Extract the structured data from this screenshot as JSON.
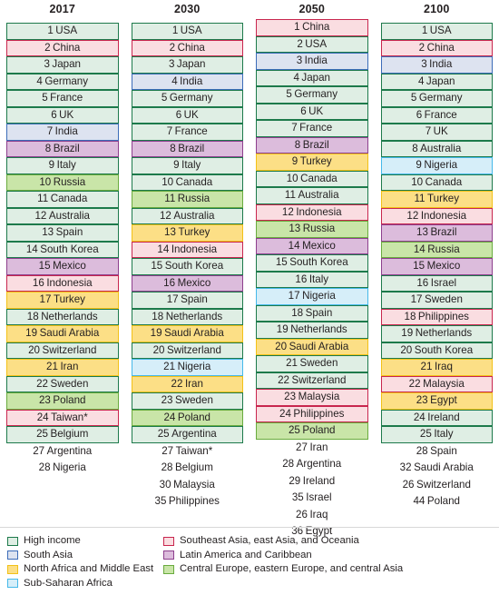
{
  "chart_data": {
    "type": "table",
    "title": "",
    "columns": [
      {
        "header": "2017",
        "ranked": [
          {
            "rank": "1",
            "name": "USA",
            "category": "high"
          },
          {
            "rank": "2",
            "name": "China",
            "category": "seasia"
          },
          {
            "rank": "3",
            "name": "Japan",
            "category": "high"
          },
          {
            "rank": "4",
            "name": "Germany",
            "category": "high"
          },
          {
            "rank": "5",
            "name": "France",
            "category": "high"
          },
          {
            "rank": "6",
            "name": "UK",
            "category": "high"
          },
          {
            "rank": "7",
            "name": "India",
            "category": "south"
          },
          {
            "rank": "8",
            "name": "Brazil",
            "category": "latam"
          },
          {
            "rank": "9",
            "name": "Italy",
            "category": "high"
          },
          {
            "rank": "10",
            "name": "Russia",
            "category": "ceurope"
          },
          {
            "rank": "11",
            "name": "Canada",
            "category": "high"
          },
          {
            "rank": "12",
            "name": "Australia",
            "category": "high"
          },
          {
            "rank": "13",
            "name": "Spain",
            "category": "high"
          },
          {
            "rank": "14",
            "name": "South Korea",
            "category": "high"
          },
          {
            "rank": "15",
            "name": "Mexico",
            "category": "latam"
          },
          {
            "rank": "16",
            "name": "Indonesia",
            "category": "seasia"
          },
          {
            "rank": "17",
            "name": "Turkey",
            "category": "nafrica"
          },
          {
            "rank": "18",
            "name": "Netherlands",
            "category": "high"
          },
          {
            "rank": "19",
            "name": "Saudi Arabia",
            "category": "nafrica"
          },
          {
            "rank": "20",
            "name": "Switzerland",
            "category": "high"
          },
          {
            "rank": "21",
            "name": "Iran",
            "category": "nafrica"
          },
          {
            "rank": "22",
            "name": "Sweden",
            "category": "high"
          },
          {
            "rank": "23",
            "name": "Poland",
            "category": "ceurope"
          },
          {
            "rank": "24",
            "name": "Taiwan*",
            "category": "seasia"
          },
          {
            "rank": "25",
            "name": "Belgium",
            "category": "high"
          }
        ],
        "extra": [
          {
            "rank": "27",
            "name": "Argentina"
          },
          {
            "rank": "28",
            "name": "Nigeria"
          }
        ]
      },
      {
        "header": "2030",
        "ranked": [
          {
            "rank": "1",
            "name": "USA",
            "category": "high"
          },
          {
            "rank": "2",
            "name": "China",
            "category": "seasia"
          },
          {
            "rank": "3",
            "name": "Japan",
            "category": "high"
          },
          {
            "rank": "4",
            "name": "India",
            "category": "south"
          },
          {
            "rank": "5",
            "name": "Germany",
            "category": "high"
          },
          {
            "rank": "6",
            "name": "UK",
            "category": "high"
          },
          {
            "rank": "7",
            "name": "France",
            "category": "high"
          },
          {
            "rank": "8",
            "name": "Brazil",
            "category": "latam"
          },
          {
            "rank": "9",
            "name": "Italy",
            "category": "high"
          },
          {
            "rank": "10",
            "name": "Canada",
            "category": "high"
          },
          {
            "rank": "11",
            "name": "Russia",
            "category": "ceurope"
          },
          {
            "rank": "12",
            "name": "Australia",
            "category": "high"
          },
          {
            "rank": "13",
            "name": "Turkey",
            "category": "nafrica"
          },
          {
            "rank": "14",
            "name": "Indonesia",
            "category": "seasia"
          },
          {
            "rank": "15",
            "name": "South Korea",
            "category": "high"
          },
          {
            "rank": "16",
            "name": "Mexico",
            "category": "latam"
          },
          {
            "rank": "17",
            "name": "Spain",
            "category": "high"
          },
          {
            "rank": "18",
            "name": "Netherlands",
            "category": "high"
          },
          {
            "rank": "19",
            "name": "Saudi Arabia",
            "category": "nafrica"
          },
          {
            "rank": "20",
            "name": "Switzerland",
            "category": "high"
          },
          {
            "rank": "21",
            "name": "Nigeria",
            "category": "subsah"
          },
          {
            "rank": "22",
            "name": "Iran",
            "category": "nafrica"
          },
          {
            "rank": "23",
            "name": "Sweden",
            "category": "high"
          },
          {
            "rank": "24",
            "name": "Poland",
            "category": "ceurope"
          },
          {
            "rank": "25",
            "name": "Argentina",
            "category": "high"
          }
        ],
        "extra": [
          {
            "rank": "27",
            "name": "Taiwan*"
          },
          {
            "rank": "28",
            "name": "Belgium"
          },
          {
            "rank": "30",
            "name": "Malaysia"
          },
          {
            "rank": "35",
            "name": "Philippines"
          }
        ]
      },
      {
        "header": "2050",
        "ranked": [
          {
            "rank": "1",
            "name": "China",
            "category": "seasia"
          },
          {
            "rank": "2",
            "name": "USA",
            "category": "high"
          },
          {
            "rank": "3",
            "name": "India",
            "category": "south"
          },
          {
            "rank": "4",
            "name": "Japan",
            "category": "high"
          },
          {
            "rank": "5",
            "name": "Germany",
            "category": "high"
          },
          {
            "rank": "6",
            "name": "UK",
            "category": "high"
          },
          {
            "rank": "7",
            "name": "France",
            "category": "high"
          },
          {
            "rank": "8",
            "name": "Brazil",
            "category": "latam"
          },
          {
            "rank": "9",
            "name": "Turkey",
            "category": "nafrica"
          },
          {
            "rank": "10",
            "name": "Canada",
            "category": "high"
          },
          {
            "rank": "11",
            "name": "Australia",
            "category": "high"
          },
          {
            "rank": "12",
            "name": "Indonesia",
            "category": "seasia"
          },
          {
            "rank": "13",
            "name": "Russia",
            "category": "ceurope"
          },
          {
            "rank": "14",
            "name": "Mexico",
            "category": "latam"
          },
          {
            "rank": "15",
            "name": "South Korea",
            "category": "high"
          },
          {
            "rank": "16",
            "name": "Italy",
            "category": "high"
          },
          {
            "rank": "17",
            "name": "Nigeria",
            "category": "subsah"
          },
          {
            "rank": "18",
            "name": "Spain",
            "category": "high"
          },
          {
            "rank": "19",
            "name": "Netherlands",
            "category": "high"
          },
          {
            "rank": "20",
            "name": "Saudi Arabia",
            "category": "nafrica"
          },
          {
            "rank": "21",
            "name": "Sweden",
            "category": "high"
          },
          {
            "rank": "22",
            "name": "Switzerland",
            "category": "high"
          },
          {
            "rank": "23",
            "name": "Malaysia",
            "category": "seasia"
          },
          {
            "rank": "24",
            "name": "Philippines",
            "category": "seasia"
          },
          {
            "rank": "25",
            "name": "Poland",
            "category": "ceurope"
          }
        ],
        "extra": [
          {
            "rank": "27",
            "name": "Iran"
          },
          {
            "rank": "28",
            "name": "Argentina"
          },
          {
            "rank": "29",
            "name": "Ireland"
          },
          {
            "rank": "35",
            "name": "Israel"
          },
          {
            "rank": "26",
            "name": "Iraq"
          },
          {
            "rank": "36",
            "name": "Egypt"
          }
        ]
      },
      {
        "header": "2100",
        "ranked": [
          {
            "rank": "1",
            "name": "USA",
            "category": "high"
          },
          {
            "rank": "2",
            "name": "China",
            "category": "seasia"
          },
          {
            "rank": "3",
            "name": "India",
            "category": "south"
          },
          {
            "rank": "4",
            "name": "Japan",
            "category": "high"
          },
          {
            "rank": "5",
            "name": "Germany",
            "category": "high"
          },
          {
            "rank": "6",
            "name": "France",
            "category": "high"
          },
          {
            "rank": "7",
            "name": "UK",
            "category": "high"
          },
          {
            "rank": "8",
            "name": "Australia",
            "category": "high"
          },
          {
            "rank": "9",
            "name": "Nigeria",
            "category": "subsah"
          },
          {
            "rank": "10",
            "name": "Canada",
            "category": "high"
          },
          {
            "rank": "11",
            "name": "Turkey",
            "category": "nafrica"
          },
          {
            "rank": "12",
            "name": "Indonesia",
            "category": "seasia"
          },
          {
            "rank": "13",
            "name": "Brazil",
            "category": "latam"
          },
          {
            "rank": "14",
            "name": "Russia",
            "category": "ceurope"
          },
          {
            "rank": "15",
            "name": "Mexico",
            "category": "latam"
          },
          {
            "rank": "16",
            "name": "Israel",
            "category": "high"
          },
          {
            "rank": "17",
            "name": "Sweden",
            "category": "high"
          },
          {
            "rank": "18",
            "name": "Philippines",
            "category": "seasia"
          },
          {
            "rank": "19",
            "name": "Netherlands",
            "category": "high"
          },
          {
            "rank": "20",
            "name": "South Korea",
            "category": "high"
          },
          {
            "rank": "21",
            "name": "Iraq",
            "category": "nafrica"
          },
          {
            "rank": "22",
            "name": "Malaysia",
            "category": "seasia"
          },
          {
            "rank": "23",
            "name": "Egypt",
            "category": "nafrica"
          },
          {
            "rank": "24",
            "name": "Ireland",
            "category": "high"
          },
          {
            "rank": "25",
            "name": "Italy",
            "category": "high"
          }
        ],
        "extra": [
          {
            "rank": "28",
            "name": "Spain"
          },
          {
            "rank": "32",
            "name": "Saudi Arabia"
          },
          {
            "rank": "26",
            "name": "Switzerland"
          },
          {
            "rank": "44",
            "name": "Poland"
          }
        ]
      }
    ],
    "legend": {
      "left": [
        {
          "label": "High income",
          "key": "high",
          "fill": "#dfeee4",
          "border": "#1d7a4b"
        },
        {
          "label": "South Asia",
          "key": "south",
          "fill": "#dde3f0",
          "border": "#3c6cb8"
        },
        {
          "label": "North Africa and Middle East",
          "key": "nafrica",
          "fill": "#fcdf86",
          "border": "#f2c117"
        },
        {
          "label": "Sub-Saharan Africa",
          "key": "subsah",
          "fill": "#d6eef9",
          "border": "#45b8e9"
        }
      ],
      "right": [
        {
          "label": "Southeast Asia, east Asia, and Oceania",
          "key": "seasia",
          "fill": "#fadde1",
          "border": "#c8264e"
        },
        {
          "label": "Latin America and Caribbean",
          "key": "latam",
          "fill": "#dcbcdc",
          "border": "#8d3f8d"
        },
        {
          "label": "Central Europe, eastern Europe, and central Asia",
          "key": "ceurope",
          "fill": "#c9e5a8",
          "border": "#69ab3e"
        }
      ]
    }
  }
}
